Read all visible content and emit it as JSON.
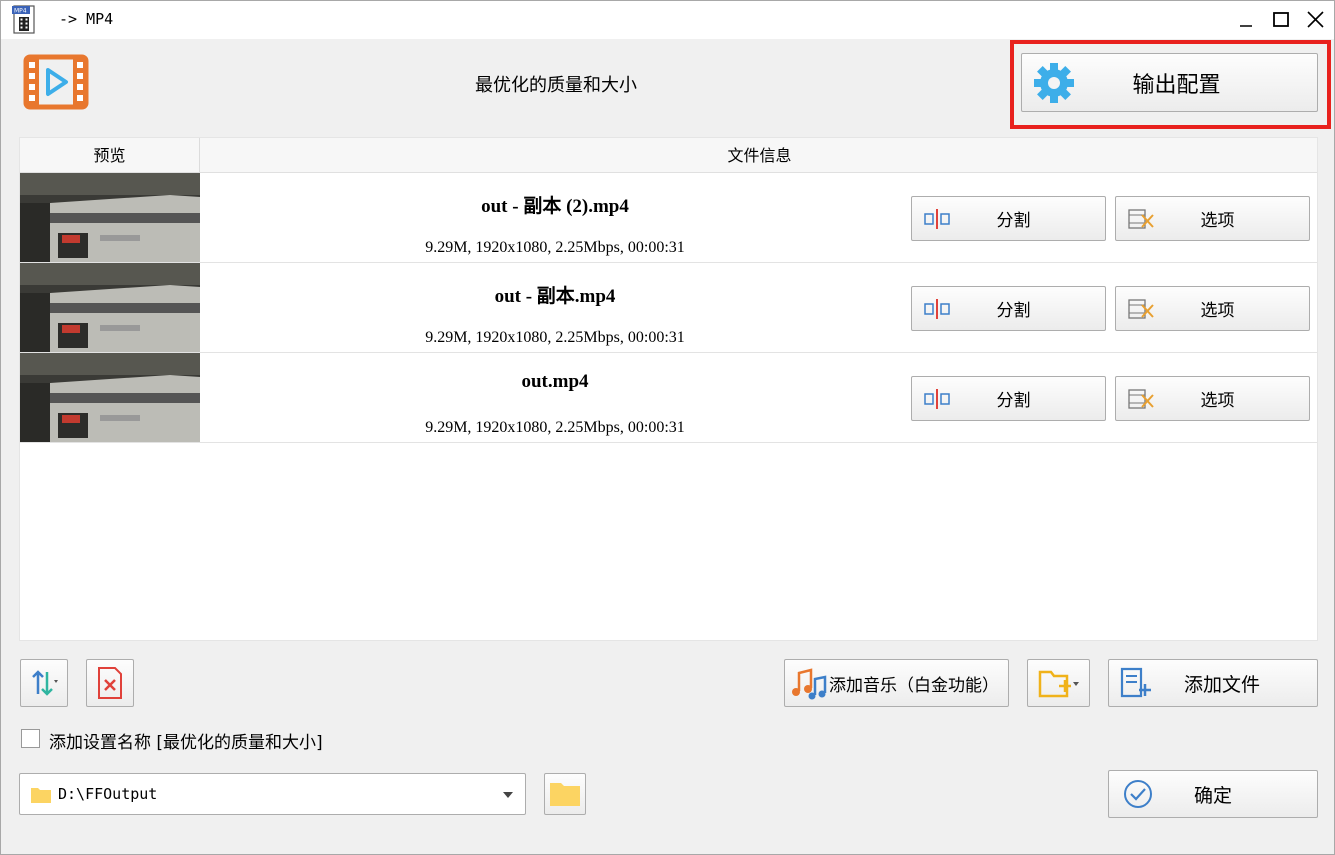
{
  "window": {
    "title": "-> MP4"
  },
  "header": {
    "profile_name": "最优化的质量和大小",
    "output_settings_label": "输出配置"
  },
  "columns": {
    "preview": "预览",
    "file_info": "文件信息"
  },
  "files": [
    {
      "name": "out - 副本 (2).mp4",
      "meta": "9.29M, 1920x1080, 2.25Mbps, 00:00:31",
      "split_label": "分割",
      "options_label": "选项"
    },
    {
      "name": "out - 副本.mp4",
      "meta": "9.29M, 1920x1080, 2.25Mbps, 00:00:31",
      "split_label": "分割",
      "options_label": "选项"
    },
    {
      "name": "out.mp4",
      "meta": "9.29M, 1920x1080, 2.25Mbps, 00:00:31",
      "split_label": "分割",
      "options_label": "选项"
    }
  ],
  "toolbar": {
    "add_music_label": "添加音乐（白金功能）",
    "add_file_label": "添加文件"
  },
  "settings": {
    "add_name_label": "添加设置名称 [最优化的质量和大小]",
    "add_name_checked": false
  },
  "output": {
    "path": "D:\\FFOutput",
    "confirm_label": "确定"
  },
  "colors": {
    "highlight": "#e8211d",
    "accent_orange": "#e8772e",
    "gear_blue": "#3daee9"
  }
}
